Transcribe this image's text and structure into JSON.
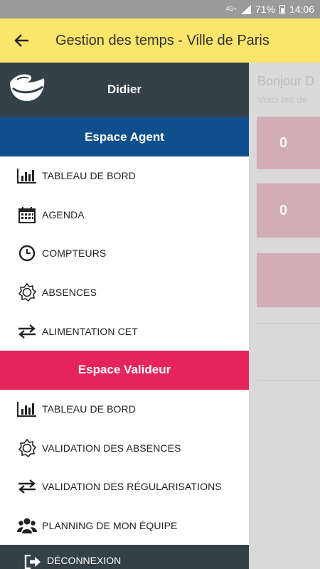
{
  "status_bar": {
    "network": "4G+",
    "battery": "71%",
    "time": "14:06"
  },
  "app_bar": {
    "title": "Gestion des temps - Ville de Paris"
  },
  "background_page": {
    "greeting": "Bonjour D",
    "subtitle": "Voici les de",
    "tile_values": [
      "0",
      "0"
    ]
  },
  "drawer": {
    "user_name": "Didier",
    "agent_section": {
      "title": "Espace Agent",
      "items": [
        {
          "label": "TABLEAU DE BORD",
          "icon": "bar-chart-icon"
        },
        {
          "label": "AGENDA",
          "icon": "calendar-icon"
        },
        {
          "label": "COMPTEURS",
          "icon": "clock-icon"
        },
        {
          "label": "ABSENCES",
          "icon": "sun-icon"
        },
        {
          "label": "ALIMENTATION CET",
          "icon": "exchange-arrows-icon"
        }
      ]
    },
    "valideur_section": {
      "title": "Espace Valideur",
      "items": [
        {
          "label": "TABLEAU DE BORD",
          "icon": "bar-chart-icon"
        },
        {
          "label": "VALIDATION DES ABSENCES",
          "icon": "sun-icon"
        },
        {
          "label": "VALIDATION DES RÉGULARISATIONS",
          "icon": "exchange-arrows-icon"
        },
        {
          "label": "PLANNING DE MON ÉQUIPE",
          "icon": "team-icon"
        }
      ]
    },
    "logout_label": "DÉCONNEXION"
  },
  "colors": {
    "app_bar": "#fce56b",
    "drawer_header": "#344149",
    "agent_section": "#0f4f8d",
    "valideur_section": "#e4245b"
  }
}
